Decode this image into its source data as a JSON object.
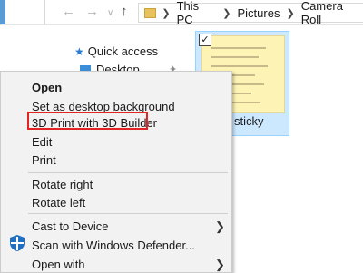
{
  "explorer": {
    "breadcrumb": [
      "This PC",
      "Pictures",
      "Camera Roll"
    ],
    "quick_access_label": "Quick access",
    "desktop_label": "Desktop",
    "file_label": "sticky"
  },
  "context_menu": {
    "items": [
      {
        "label": "Open"
      },
      {
        "label": "Set as desktop background"
      },
      {
        "label": "3D Print with 3D Builder",
        "highlighted": true
      },
      {
        "label": "Edit"
      },
      {
        "label": "Print"
      },
      {
        "label": "Rotate right"
      },
      {
        "label": "Rotate left"
      },
      {
        "label": "Cast to Device",
        "has_submenu": true
      },
      {
        "label": "Scan with Windows Defender...",
        "icon": "windows-defender-shield-icon"
      },
      {
        "label": "Open with",
        "has_submenu": true
      }
    ]
  },
  "colors": {
    "highlight_border": "#e32424",
    "selected_tile": "#cce8ff",
    "menu_background": "#f2f2f2"
  }
}
